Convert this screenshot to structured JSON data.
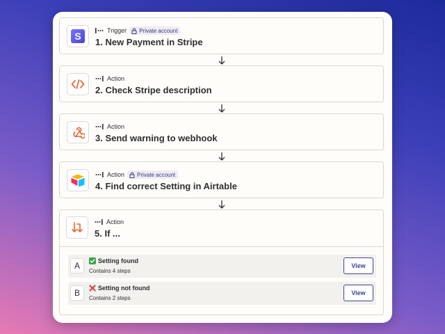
{
  "steps": [
    {
      "kind": "Trigger",
      "badge": "Private account",
      "title": "1. New Payment in Stripe",
      "icon": "stripe-logo-icon"
    },
    {
      "kind": "Action",
      "title": "2. Check Stripe description",
      "icon": "code-icon"
    },
    {
      "kind": "Action",
      "title": "3. Send warning to webhook",
      "icon": "webhook-icon"
    },
    {
      "kind": "Action",
      "badge": "Private account",
      "title": "4. Find correct Setting in Airtable",
      "icon": "airtable-logo-icon"
    },
    {
      "kind": "Action",
      "title": "5. If ...",
      "icon": "branch-arrows-icon"
    }
  ],
  "branches": [
    {
      "letter": "A",
      "status_icon": "check-mark-icon",
      "name": "Setting found",
      "subtitle": "Contains 4 steps",
      "button": "View"
    },
    {
      "letter": "B",
      "status_icon": "cross-mark-icon",
      "name": "Setting not found",
      "subtitle": "Contains 2 steps",
      "button": "View"
    }
  ],
  "colors": {
    "accent": "#3d4592",
    "action_icon": "#e8652f",
    "stripe": "#635bff",
    "check": "#3aa34a",
    "cross": "#e0443e"
  }
}
